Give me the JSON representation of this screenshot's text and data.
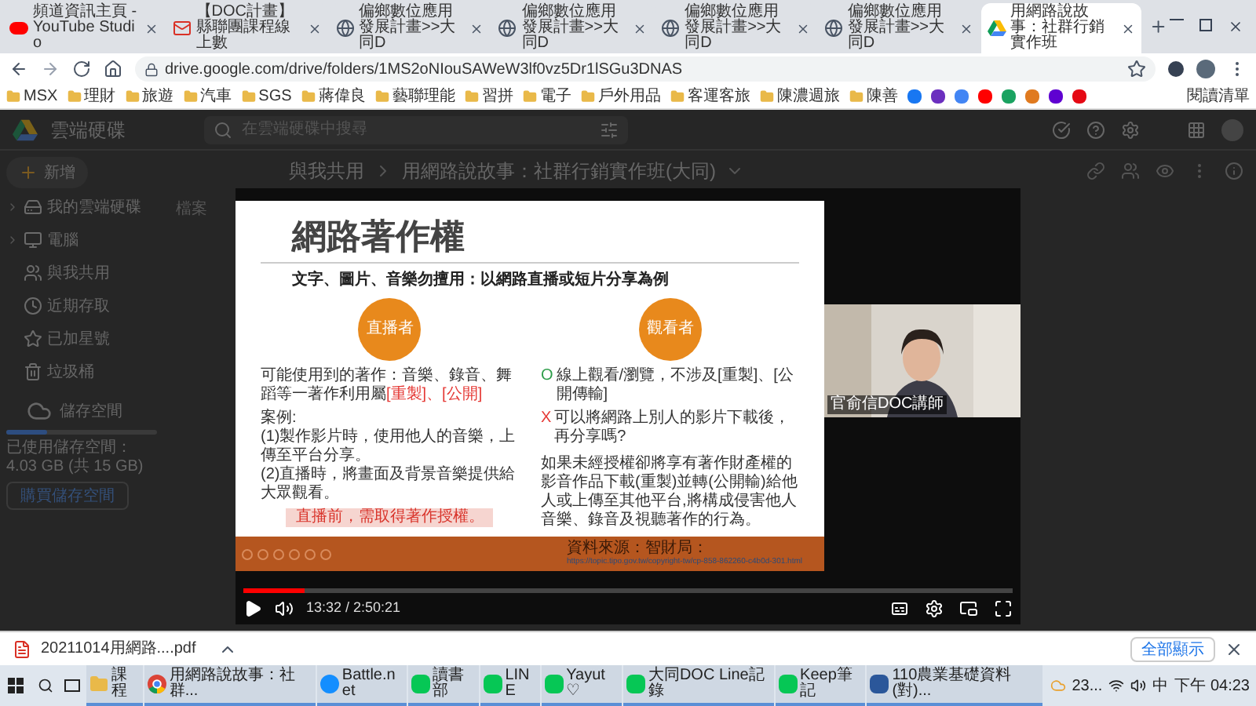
{
  "browser": {
    "tabs": [
      {
        "title": "頻道資訊主頁 - YouTube Studio",
        "kind": "youtube",
        "selected": false
      },
      {
        "title": "【DOC計畫】縣聯團課程線上數",
        "kind": "gmail",
        "selected": false
      },
      {
        "title": "偏鄉數位應用發展計畫>>大同D",
        "kind": "site",
        "selected": false
      },
      {
        "title": "偏鄉數位應用發展計畫>>大同D",
        "kind": "site",
        "selected": false
      },
      {
        "title": "偏鄉數位應用發展計畫>>大同D",
        "kind": "site",
        "selected": false
      },
      {
        "title": "偏鄉數位應用發展計畫>>大同D",
        "kind": "site",
        "selected": false
      },
      {
        "title": "用網路說故事：社群行銷實作班",
        "kind": "drive",
        "selected": true
      }
    ],
    "url": "drive.google.com/drive/folders/1MS2oNIouSAWeW3lf0vz5Dr1lSGu3DNAS",
    "bookmarks": [
      "MSX",
      "理財",
      "旅遊",
      "汽車",
      "SGS",
      "蔣偉良",
      "藝聯理能",
      "習拼",
      "電子",
      "戶外用品",
      "客運客旅",
      "陳濃週旅",
      "陳善"
    ],
    "reading_list": "閱讀清單"
  },
  "drive": {
    "app_name": "雲端硬碟",
    "search": {
      "placeholder": "在雲端硬碟中搜尋"
    },
    "new_button": "新增",
    "nav": [
      {
        "label": "我的雲端硬碟",
        "kind": "drive",
        "expandable": true
      },
      {
        "label": "電腦",
        "kind": "computer",
        "expandable": true
      },
      {
        "label": "與我共用",
        "kind": "shared",
        "expandable": false
      },
      {
        "label": "近期存取",
        "kind": "recent",
        "expandable": false
      },
      {
        "label": "已加星號",
        "kind": "starred",
        "expandable": false
      },
      {
        "label": "垃圾桶",
        "kind": "trash",
        "expandable": false
      }
    ],
    "storage": {
      "label": "儲存空間",
      "usage": "已使用儲存空間：4.03 GB (共 15 GB)",
      "level": 0.27,
      "buy": "購買儲存空間"
    },
    "breadcrumb": [
      "與我共用",
      "用網路說故事：社群行銷實作班(大同)"
    ],
    "files_heading": "檔案"
  },
  "video": {
    "slide": {
      "title": "網路著作權",
      "subtitle": "文字、圖片、音樂勿擅用：以網路直播或短片分享為例",
      "roles": [
        "直播者",
        "觀看者"
      ],
      "left_text": [
        {
          "text": "可能使用到的著作：音樂、錄音、舞蹈等一著作利用屬",
          "highlight": false
        },
        {
          "text": "[重製]、[公開]",
          "highlight": true
        }
      ],
      "cases_heading": "案例:",
      "cases": [
        "(1)製作影片時，使用他人的音樂，上傳至平台分享。",
        "(2)直播時，將畫面及背景音樂提供給大眾觀看。"
      ],
      "notice": "直播前，需取得著作授權。",
      "right_points": [
        {
          "mark": "O",
          "kind": "ok",
          "text": "線上觀看/瀏覽，不涉及[重製]、[公開傳輸]"
        },
        {
          "mark": "X",
          "kind": "no",
          "text": "可以將網路上別人的影片下載後，再分享嗎?"
        }
      ],
      "right_text": "如果未經授權卻將享有著作財產權的影音作品下載(重製)並轉(公開輸)給他人或上傳至其他平台,將構成侵害他人音樂、錄音及視聽著作的行為。",
      "source_label": "資料來源：智財局：",
      "source_link": "https://topic.tipo.gov.tw/copyright-tw/cp-858-862260-c4b0d-301.html"
    },
    "webcam_label": "官俞信DOC講師",
    "time": "13:32 / 2:50:21",
    "level": 0.08
  },
  "download": {
    "file": "20211014用網路....pdf",
    "show_all": "全部顯示"
  },
  "taskbar": {
    "apps": [
      {
        "label": "課程",
        "kind": "folder"
      },
      {
        "label": "用網路說故事：社群...",
        "kind": "chrome"
      },
      {
        "label": "Battle.net",
        "kind": "battle"
      },
      {
        "label": "讀書部",
        "kind": "line"
      },
      {
        "label": "LINE",
        "kind": "line"
      },
      {
        "label": "Yayut ♡",
        "kind": "line"
      },
      {
        "label": "大同DOC Line記錄",
        "kind": "line"
      },
      {
        "label": "Keep筆記",
        "kind": "line"
      },
      {
        "label": "110農業基礎資料(對)...",
        "kind": "word"
      }
    ],
    "weather": "23...",
    "ime": "中",
    "clock": "下午 04:23"
  }
}
